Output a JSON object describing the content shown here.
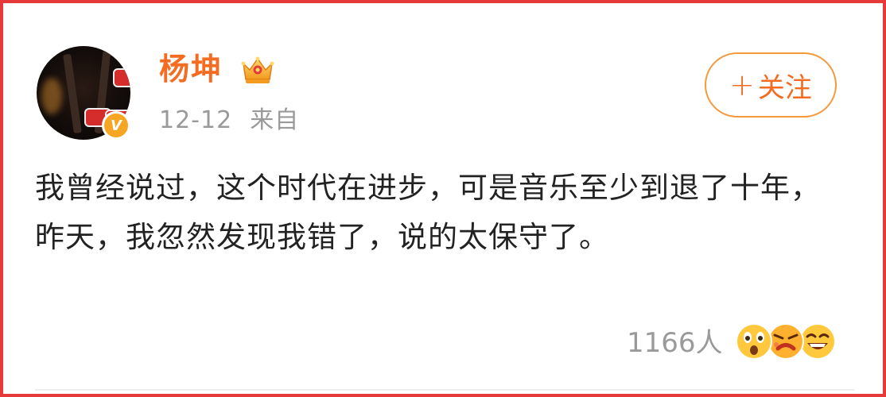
{
  "post": {
    "author": {
      "name": "杨坤",
      "verified_badge": "V"
    },
    "meta": {
      "date": "12-12",
      "source_label": "来自"
    },
    "follow_button": {
      "plus": "+",
      "label": "关注"
    },
    "content": {
      "text": "我曾经说过，这个时代在进步，可是音乐至少到退了十年，昨天，我忽然发现我错了，说的太保守了。"
    },
    "reactions": {
      "count_label": "1166人",
      "emojis": [
        "surprised-emoji-icon",
        "angry-emoji-icon",
        "laughing-emoji-icon"
      ]
    }
  },
  "colors": {
    "frame_border": "#e5393a",
    "accent_orange": "#f36c21",
    "follow_border": "#f39a3d",
    "meta_gray": "#9a9a9a",
    "text": "#222222",
    "emoji_yellow": "#ffc83d"
  }
}
